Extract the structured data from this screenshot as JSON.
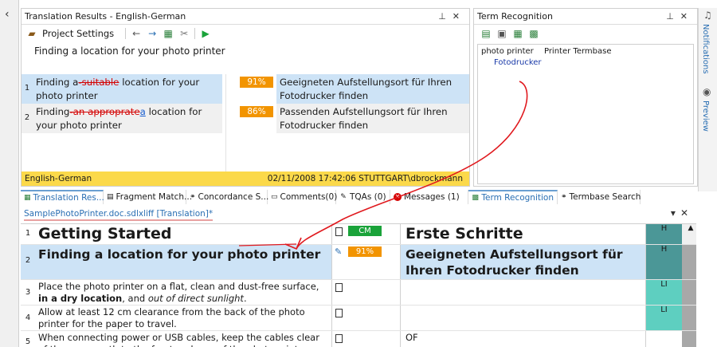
{
  "translation_results": {
    "title": "Translation Results - English-German",
    "project_settings_label": "Project Settings",
    "source_segment": "Finding a location for your photo printer",
    "results": [
      {
        "index": "1",
        "source_parts": [
          {
            "text": "Finding a",
            "style": "normal"
          },
          {
            "text": "-suitable",
            "style": "del"
          },
          {
            "text": " location for your photo printer",
            "style": "normal"
          }
        ],
        "match": "91%",
        "target": "Geeigneten Aufstellungsort für Ihren Fotodrucker finden"
      },
      {
        "index": "2",
        "source_parts": [
          {
            "text": "Finding",
            "style": "normal"
          },
          {
            "text": "-an approprate",
            "style": "del"
          },
          {
            "text": "a",
            "style": "ins"
          },
          {
            "text": " location for your photo printer",
            "style": "normal"
          }
        ],
        "match": "86%",
        "target": "Passenden Aufstellungsort für Ihren Fotodrucker finden"
      }
    ],
    "status_bar": {
      "language_pair": "English-German",
      "info": "02/11/2008 17:42:06  STUTTGART\\dbrockmann"
    }
  },
  "term_recognition": {
    "title": "Term Recognition",
    "source_term": "photo printer",
    "termbase": "Printer Termbase",
    "target_term": "Fotodrucker"
  },
  "side_tabs": {
    "notifications": "Notifications",
    "preview": "Preview"
  },
  "bottom_tabs": [
    "Translation Res...",
    "Fragment Match...",
    "Concordance S...",
    "Comments(0)",
    "TQAs (0)",
    "Messages (1)",
    "Term Recognition",
    "Termbase Search"
  ],
  "editor": {
    "doc_tab": "SamplePhotoPrinter.doc.sdlxliff [Translation]*",
    "rows": [
      {
        "index": "1",
        "source": "Getting Started",
        "status": "CM",
        "target": "Erste Schritte",
        "type": "H"
      },
      {
        "index": "2",
        "source": "Finding a location for your photo printer",
        "status": "91%",
        "target": "Geeigneten Aufstellungsort für Ihren Fotodrucker finden",
        "type": "H"
      },
      {
        "index": "3",
        "source_a": "Place the photo printer on a flat, clean and dust-free surface, ",
        "source_b": "in a dry location",
        "source_c": ", and ",
        "source_d": "out of direct sunlight",
        "source_e": ".",
        "target": "",
        "type": "LI"
      },
      {
        "index": "4",
        "source": "Allow at least 12 cm clearance from the back of the photo printer for the paper to travel.",
        "target": "",
        "type": "LI"
      },
      {
        "index": "5",
        "source": "When connecting power or USB cables, keep the cables clear of the paper path to the front and rear of the photo printer.",
        "target": "OF",
        "type": ""
      }
    ]
  },
  "colors": {
    "match_orange": "#f29400",
    "cm_green": "#1aa33a",
    "selected_blue": "#cde3f6",
    "status_yellow": "#fbd94a",
    "annotation_red": "#e0191e"
  }
}
